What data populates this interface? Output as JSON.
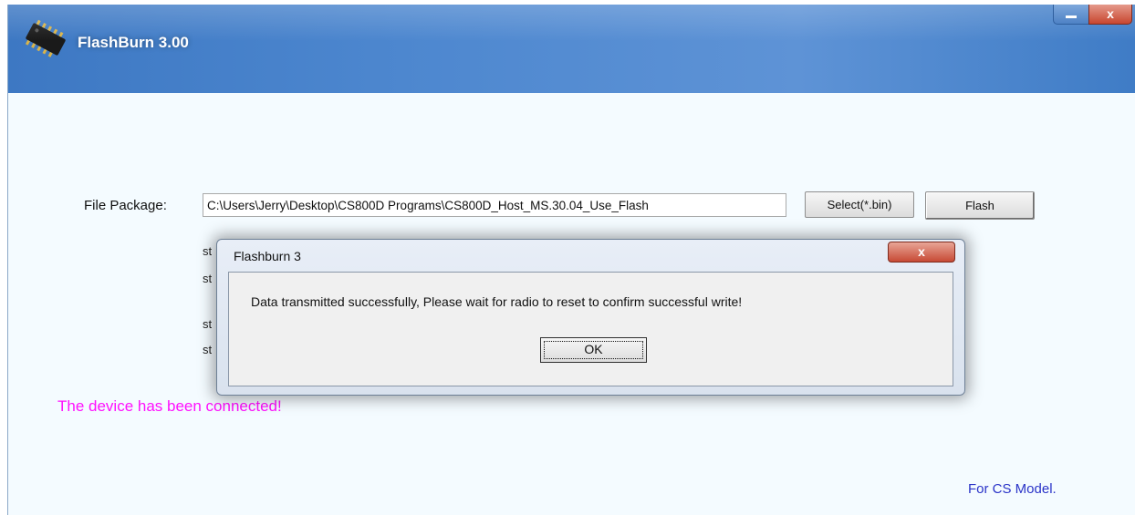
{
  "window": {
    "title": "FlashBurn 3.00",
    "minimize_label": "–",
    "close_label": "x"
  },
  "form": {
    "file_package_label": "File Package:",
    "file_package_value": "C:\\Users\\Jerry\\Desktop\\CS800D Programs\\CS800D_Host_MS.30.04_Use_Flash",
    "select_button": "Select(*.bin)",
    "flash_button": "Flash"
  },
  "steps": [
    "st",
    "st",
    "st",
    "st"
  ],
  "status": {
    "connected": "The device has been connected!",
    "model_note": "For CS Model."
  },
  "dialog": {
    "title": "Flashburn 3",
    "close_label": "x",
    "message": "Data transmitted successfully,  Please wait for radio to reset to confirm successful write!",
    "ok_label": "OK"
  },
  "colors": {
    "titlebar": "#4d87cf",
    "connected_text": "#ff10ff",
    "model_text": "#2a33c8"
  },
  "icons": {
    "app": "chip-icon",
    "close": "close-icon",
    "minimize": "minimize-icon"
  }
}
